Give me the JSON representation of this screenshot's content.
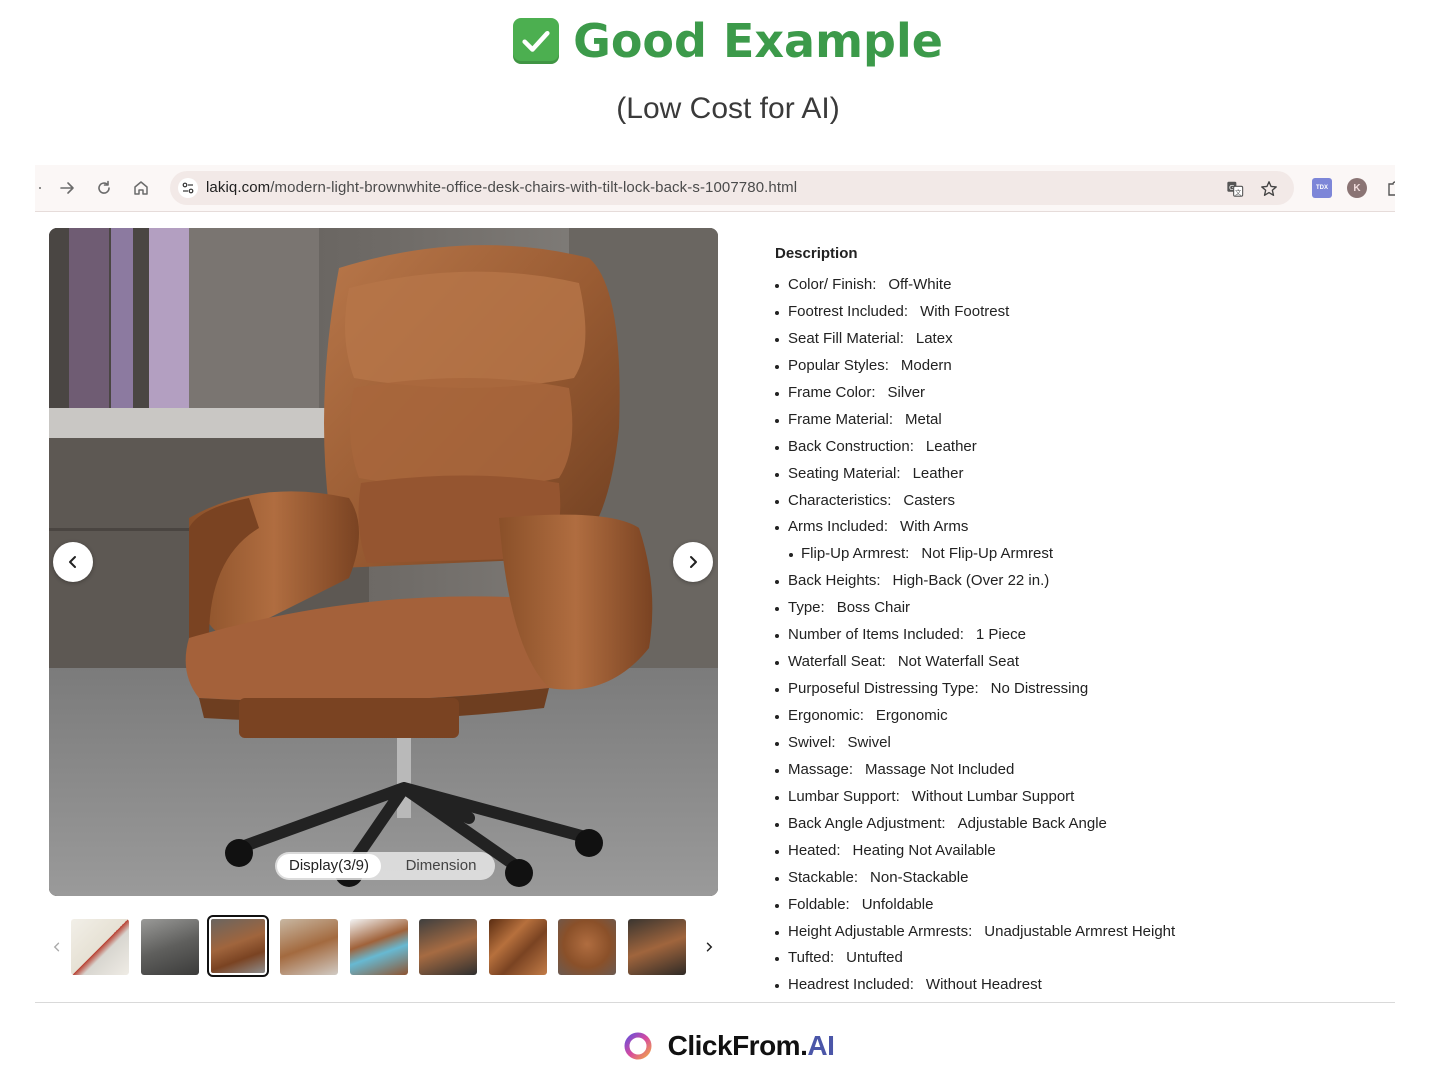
{
  "headline": {
    "emoji_icon": "check-mark-button-icon",
    "title": "Good Example",
    "subtitle": "(Low Cost for AI)",
    "title_color": "#3c9a4a"
  },
  "browser": {
    "url_host": "lakiq.com",
    "url_path": "/modern-light-brownwhite-office-desk-chairs-with-tilt-lock-back-s-1007780.html",
    "icons": [
      "back-icon",
      "forward-icon",
      "reload-icon",
      "home-icon",
      "site-settings-icon",
      "translate-icon",
      "bookmark-star-icon",
      "extension-tdx-icon",
      "profile-avatar-icon",
      "extensions-puzzle-icon"
    ],
    "extension_label": "TDX",
    "profile_initial": "K"
  },
  "gallery": {
    "toggle": {
      "display_label": "Display(3/9)",
      "dimension_label": "Dimension"
    },
    "selected_thumbnail": 3,
    "thumbnail_count": 9
  },
  "description": {
    "title": "Description",
    "items": [
      {
        "key": "Color/ Finish:",
        "value": "Off-White"
      },
      {
        "key": "Footrest Included:",
        "value": "With Footrest"
      },
      {
        "key": "Seat Fill Material:",
        "value": "Latex"
      },
      {
        "key": "Popular Styles:",
        "value": "Modern"
      },
      {
        "key": "Frame Color:",
        "value": "Silver"
      },
      {
        "key": "Frame Material:",
        "value": "Metal"
      },
      {
        "key": "Back Construction:",
        "value": "Leather"
      },
      {
        "key": "Seating Material:",
        "value": "Leather"
      },
      {
        "key": "Characteristics:",
        "value": "Casters"
      },
      {
        "key": "Arms Included:",
        "value": "With Arms"
      },
      {
        "key": "Flip-Up Armrest:",
        "value": "Not Flip-Up Armrest"
      },
      {
        "key": "Back Heights:",
        "value": "High-Back (Over 22 in.)"
      },
      {
        "key": "Type:",
        "value": "Boss Chair"
      },
      {
        "key": "Number of Items Included:",
        "value": "1 Piece"
      },
      {
        "key": "Waterfall Seat:",
        "value": "Not Waterfall Seat"
      },
      {
        "key": "Purposeful Distressing Type:",
        "value": "No Distressing"
      },
      {
        "key": "Ergonomic:",
        "value": "Ergonomic"
      },
      {
        "key": "Swivel:",
        "value": "Swivel"
      },
      {
        "key": "Massage:",
        "value": "Massage Not Included"
      },
      {
        "key": "Lumbar Support:",
        "value": "Without Lumbar Support"
      },
      {
        "key": "Back Angle Adjustment:",
        "value": "Adjustable Back Angle"
      },
      {
        "key": "Heated:",
        "value": "Heating Not Available"
      },
      {
        "key": "Stackable:",
        "value": "Non-Stackable"
      },
      {
        "key": "Foldable:",
        "value": "Unfoldable"
      },
      {
        "key": "Height Adjustable Armrests:",
        "value": "Unadjustable Armrest Height"
      },
      {
        "key": "Tufted:",
        "value": "Untufted"
      },
      {
        "key": "Headrest Included:",
        "value": "Without Headrest"
      }
    ]
  },
  "footer": {
    "brand_main": "ClickFrom.",
    "brand_accent": "AI",
    "accent_color": "#4b56a8"
  }
}
